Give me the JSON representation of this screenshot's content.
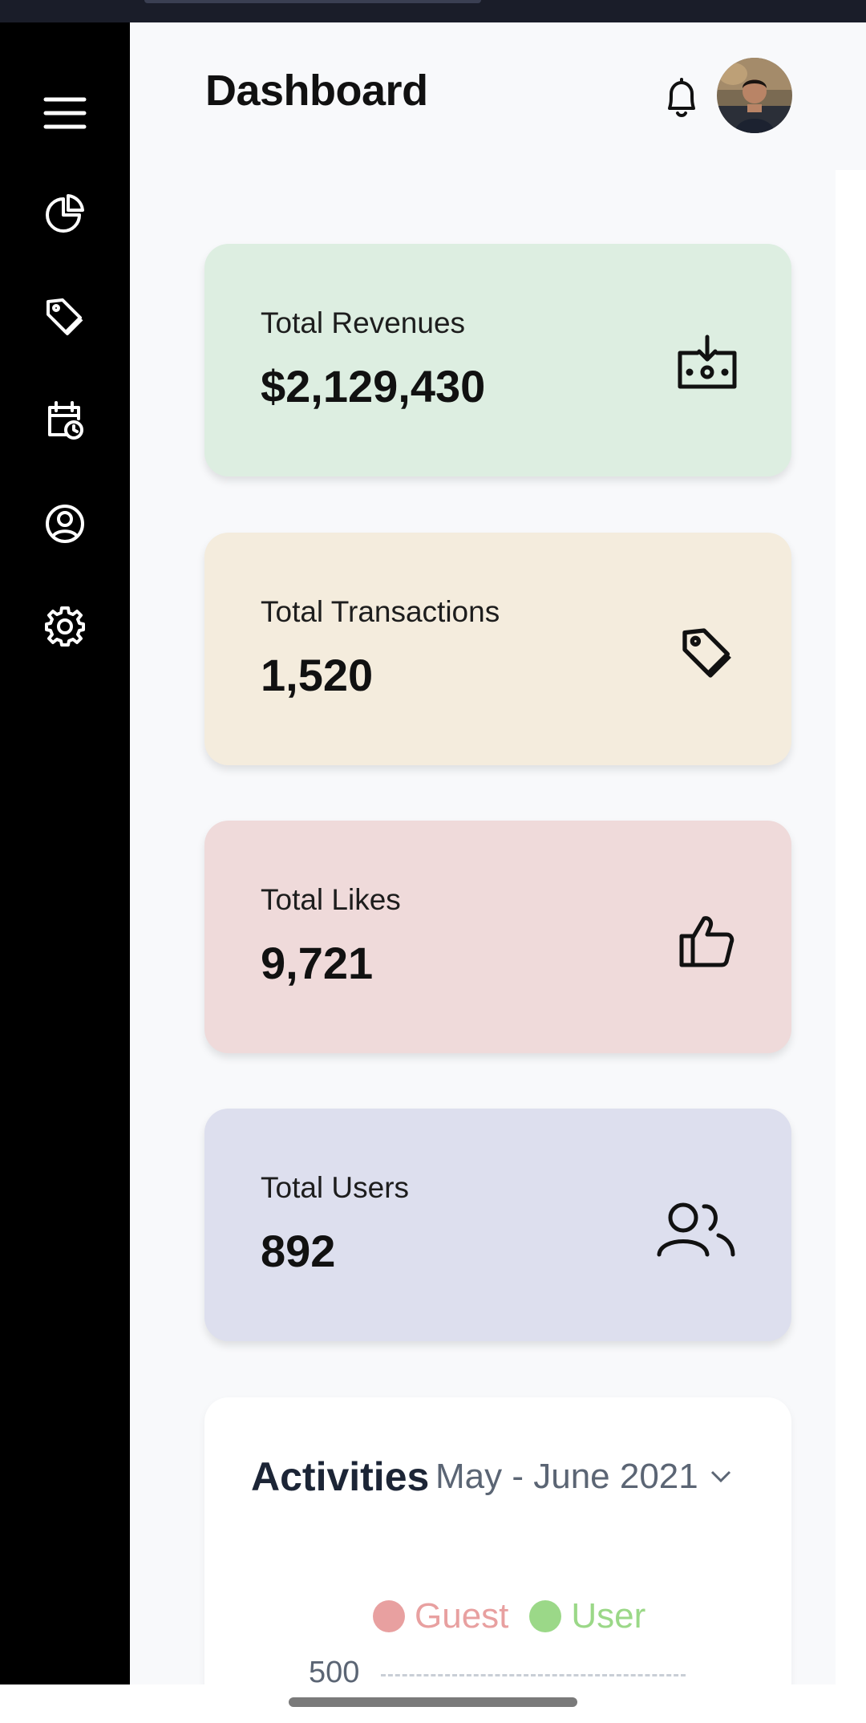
{
  "header": {
    "title": "Dashboard"
  },
  "sidebar": {
    "items": [
      {
        "icon": "menu-icon"
      },
      {
        "icon": "pie-chart-icon"
      },
      {
        "icon": "tag-icon"
      },
      {
        "icon": "calendar-icon"
      },
      {
        "icon": "user-icon"
      },
      {
        "icon": "gear-icon"
      }
    ]
  },
  "cards": [
    {
      "label": "Total Revenues",
      "value": "$2,129,430",
      "icon": "cash-icon",
      "color": "#ddeee1"
    },
    {
      "label": "Total Transactions",
      "value": "1,520",
      "icon": "tag-icon",
      "color": "#f4ecdd"
    },
    {
      "label": "Total Likes",
      "value": "9,721",
      "icon": "thumbs-up-icon",
      "color": "#efdada"
    },
    {
      "label": "Total Users",
      "value": "892",
      "icon": "users-icon",
      "color": "#dddfee"
    }
  ],
  "activities": {
    "title": "Activities",
    "range": "May - June 2021",
    "legend": [
      {
        "name": "Guest",
        "color": "#e8a0a0"
      },
      {
        "name": "User",
        "color": "#9bd888"
      }
    ],
    "y_tick": "500"
  }
}
